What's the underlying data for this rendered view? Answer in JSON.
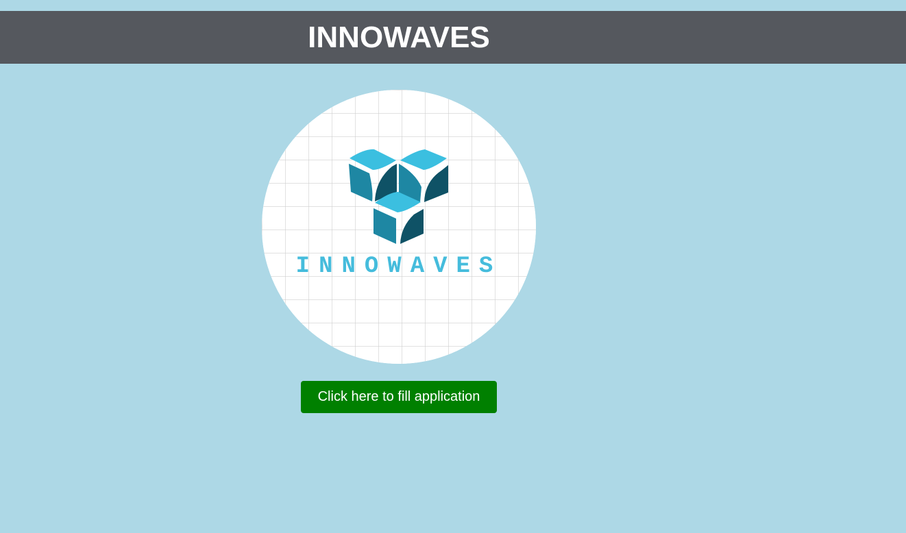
{
  "header": {
    "title": "INNOWAVES",
    "background_color": "#55585e"
  },
  "page": {
    "background_color": "#add8e6"
  },
  "logo": {
    "wordmark": "INNOWAVES",
    "icon": "innowaves-cube-logo-icon",
    "colors": {
      "light": "#3bbfe0",
      "mid": "#1e87a3",
      "dark": "#0f5266",
      "text": "#45bcdc"
    }
  },
  "apply_button": {
    "label": "Click here to fill application",
    "color": "#008000"
  }
}
